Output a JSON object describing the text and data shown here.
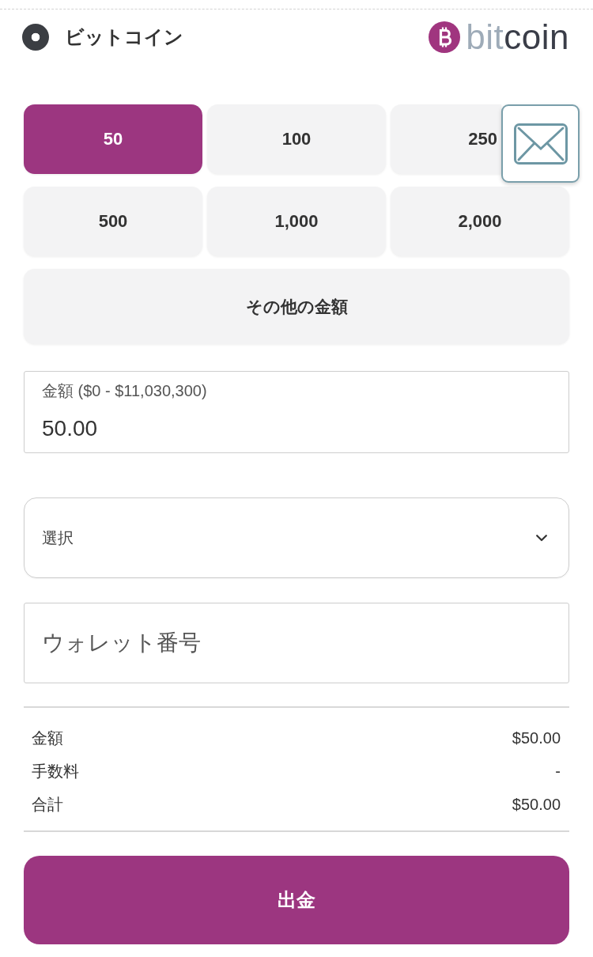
{
  "payment_method": {
    "label": "ビットコイン",
    "selected": true,
    "logo": {
      "text": "bitcoin"
    }
  },
  "amount_presets": [
    {
      "label": "50",
      "selected": true
    },
    {
      "label": "100",
      "selected": false
    },
    {
      "label": "250",
      "selected": false
    },
    {
      "label": "500",
      "selected": false
    },
    {
      "label": "1,000",
      "selected": false
    },
    {
      "label": "2,000",
      "selected": false
    }
  ],
  "other_amount": {
    "label": "その他の金額",
    "selected": false
  },
  "amount_field": {
    "label": "金額 ($0 - $11,030,300)",
    "value": "50.00"
  },
  "select_field": {
    "placeholder": "選択"
  },
  "wallet_field": {
    "placeholder": "ウォレット番号"
  },
  "summary": [
    {
      "label": "金額",
      "value": "$50.00"
    },
    {
      "label": "手数料",
      "value": "-"
    },
    {
      "label": "合計",
      "value": "$50.00"
    }
  ],
  "submit_button": {
    "label": "出金"
  }
}
